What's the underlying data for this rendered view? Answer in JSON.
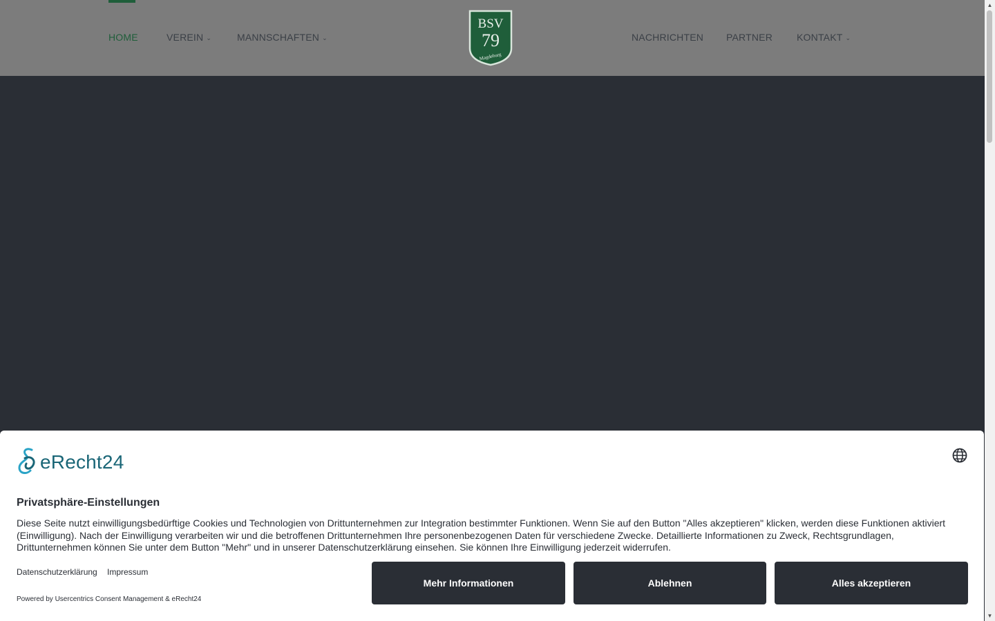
{
  "nav": {
    "left": [
      {
        "label": "HOME",
        "active": true
      },
      {
        "label": "VEREIN",
        "dropdown": true
      },
      {
        "label": "MANNSCHAFTEN",
        "dropdown": true
      }
    ],
    "right": [
      {
        "label": "NACHRICHTEN"
      },
      {
        "label": "PARTNER"
      },
      {
        "label": "KONTAKT",
        "dropdown": true
      }
    ],
    "logo": {
      "line1": "BSV",
      "line2": "79",
      "line3": "Magdeburg"
    }
  },
  "colors": {
    "accent": "#1f5e3a",
    "header_bg": "#7c7c7c",
    "hero_bg": "#2a2e35",
    "button_bg": "#2a2e35",
    "brand_teal": "#1a6677"
  },
  "consent": {
    "brand": "eRecht24",
    "language_icon": "globe-icon",
    "title": "Privatsphäre-Einstellungen",
    "text": "Diese Seite nutzt einwilligungsbedürftige Cookies und Technologien von Drittunternehmen zur Integration bestimmter Funktionen. Wenn Sie auf den Button \"Alles akzeptieren\" klicken, werden diese Funktionen aktiviert (Einwilligung). Nach der Einwilligung verarbeiten wir und die betroffenen Drittunternehmen Ihre personenbezogenen Daten für verschiedene Zwecke. Detaillierte Informationen zu Zweck, Rechtsgrundlagen, Drittunternehmen können Sie unter dem Button \"Mehr\" und in unserer Datenschutzerklärung einsehen. Sie können Ihre Einwilligung jederzeit widerrufen.",
    "links": {
      "privacy": "Datenschutzerklärung",
      "imprint": "Impressum"
    },
    "powered_by": "Powered by Usercentrics Consent Management & eRecht24",
    "buttons": {
      "more": "Mehr Informationen",
      "deny": "Ablehnen",
      "accept": "Alles akzeptieren"
    }
  }
}
